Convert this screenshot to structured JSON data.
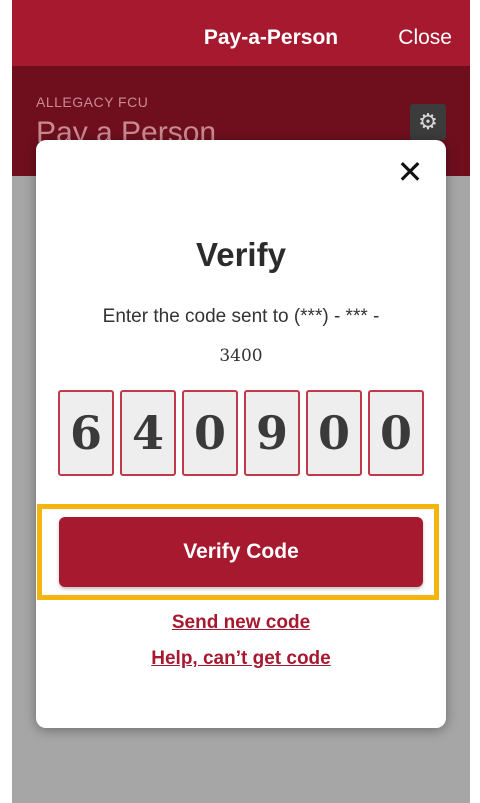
{
  "nav": {
    "title": "Pay-a-Person",
    "close_label": "Close"
  },
  "subheader": {
    "brand": "ALLEGACY FCU",
    "heading": "Pay a Person",
    "settings_icon": "gear-icon"
  },
  "modal": {
    "close_icon": "close-icon",
    "title": "Verify",
    "instruction": "Enter the code sent to (***) - *** -",
    "phone_suffix": "3400",
    "code_digits": [
      "6",
      "4",
      "0",
      "9",
      "0",
      "0"
    ],
    "verify_button": "Verify Code",
    "send_new_code": "Send new code",
    "help_link": "Help, can’t get code"
  },
  "colors": {
    "brand_red": "#a7192f",
    "dark_red": "#6f0f1e",
    "highlight": "#f5b50f",
    "overlay": "#a6a6a6"
  }
}
